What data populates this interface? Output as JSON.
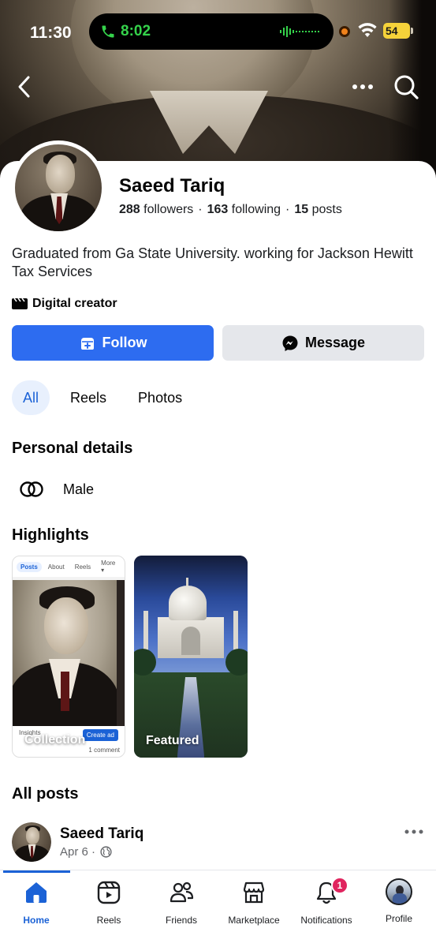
{
  "status_bar": {
    "time": "11:30",
    "call_time": "8:02",
    "battery": "54"
  },
  "profile": {
    "name": "Saeed Tariq",
    "followers_count": "288",
    "followers_label": "followers",
    "following_count": "163",
    "following_label": "following",
    "posts_count": "15",
    "posts_label": "posts",
    "bio": "Graduated from  Ga State University. working for Jackson Hewitt Tax Services",
    "category": "Digital creator"
  },
  "actions": {
    "follow_label": "Follow",
    "message_label": "Message"
  },
  "tabs": [
    {
      "label": "All",
      "active": true
    },
    {
      "label": "Reels",
      "active": false
    },
    {
      "label": "Photos",
      "active": false
    }
  ],
  "personal_details": {
    "title": "Personal details",
    "gender_icon": "gender-icon",
    "gender": "Male"
  },
  "highlights": {
    "title": "Highlights",
    "items": [
      {
        "label": "Collection",
        "preview": {
          "tabs": [
            "Posts",
            "About",
            "Reels",
            "More ▾"
          ],
          "insights": "Insights",
          "create_ad": "Create ad",
          "comment": "1 comment"
        }
      },
      {
        "label": "Featured"
      }
    ]
  },
  "posts": {
    "title": "All posts",
    "items": [
      {
        "author": "Saeed Tariq",
        "date": "Apr 6",
        "visibility_icon": "globe-icon"
      }
    ]
  },
  "nav": {
    "items": [
      {
        "label": "Home",
        "icon": "home-icon",
        "active": true
      },
      {
        "label": "Reels",
        "icon": "reels-icon",
        "active": false
      },
      {
        "label": "Friends",
        "icon": "friends-icon",
        "active": false
      },
      {
        "label": "Marketplace",
        "icon": "marketplace-icon",
        "active": false
      },
      {
        "label": "Notifications",
        "icon": "bell-icon",
        "active": false,
        "badge": "1"
      },
      {
        "label": "Profile",
        "icon": "profile-avatar",
        "active": false
      }
    ]
  },
  "colors": {
    "accent": "#2d6cf0",
    "active_tab_bg": "#e8f0fd",
    "badge": "#e0245e"
  }
}
